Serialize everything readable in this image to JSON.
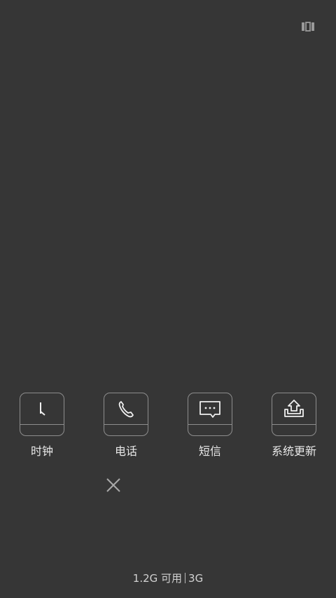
{
  "status": {
    "top_right_icon": "task-manager-icon"
  },
  "recent_apps": [
    {
      "label": "时钟",
      "icon": "clock-icon"
    },
    {
      "label": "电话",
      "icon": "phone-icon"
    },
    {
      "label": "短信",
      "icon": "message-icon"
    },
    {
      "label": "系统更新",
      "icon": "update-icon"
    }
  ],
  "close": {
    "icon": "close-icon"
  },
  "memory": {
    "available": "1.2G 可用",
    "total": "3G"
  },
  "colors": {
    "background": "#363636",
    "card_border": "#8d8d8d",
    "text": "#e8e8e8"
  }
}
